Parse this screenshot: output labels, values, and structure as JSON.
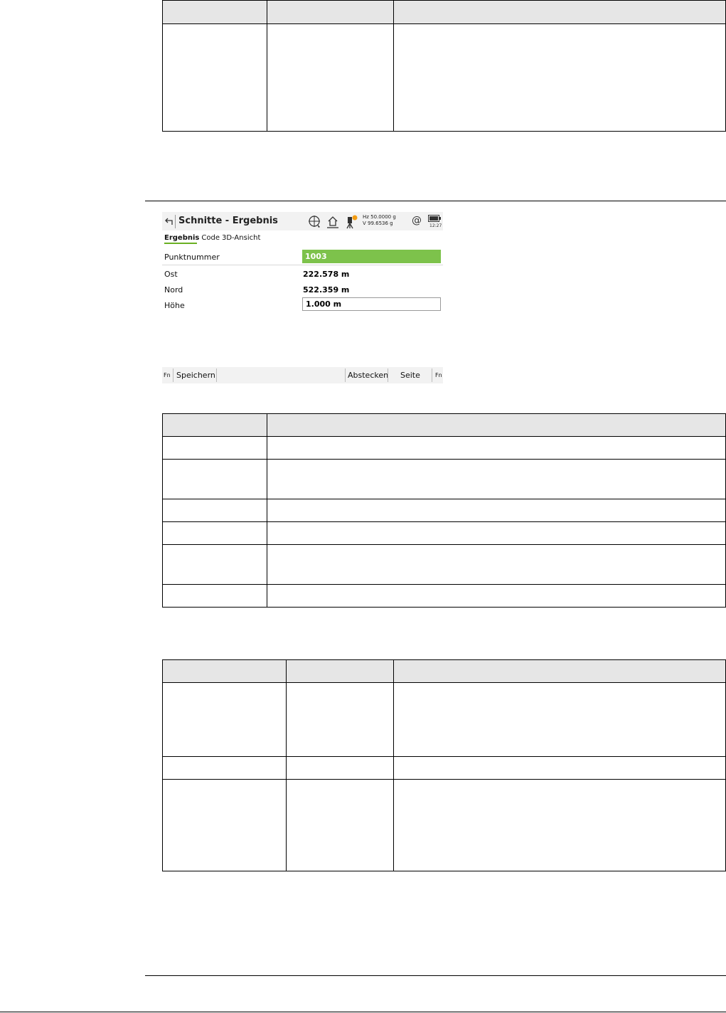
{
  "screen": {
    "title": "Schnitte - Ergebnis",
    "hz_readout": "Hz 50.0000 g",
    "v_readout": "V   99.6536 g",
    "at_symbol": "@",
    "battery_time": "12:27",
    "tabs": [
      "Ergebnis",
      "Code",
      "3D-Ansicht"
    ],
    "fields": {
      "punktnummer_label": "Punktnummer",
      "punktnummer_value": "1003",
      "ost_label": "Ost",
      "ost_value": "222.578 m",
      "nord_label": "Nord",
      "nord_value": "522.359 m",
      "hoehe_label": "Höhe",
      "hoehe_value": "1.000 m"
    },
    "softkeys": {
      "fn_left": "Fn",
      "speichern": "Speichern",
      "abstecken": "Abstecken",
      "seite": "Seite",
      "fn_right": "Fn"
    },
    "colors": {
      "accent_green": "#7dc24b",
      "tab_underline": "#6ab023",
      "bar_background": "#f2f2f2"
    }
  }
}
